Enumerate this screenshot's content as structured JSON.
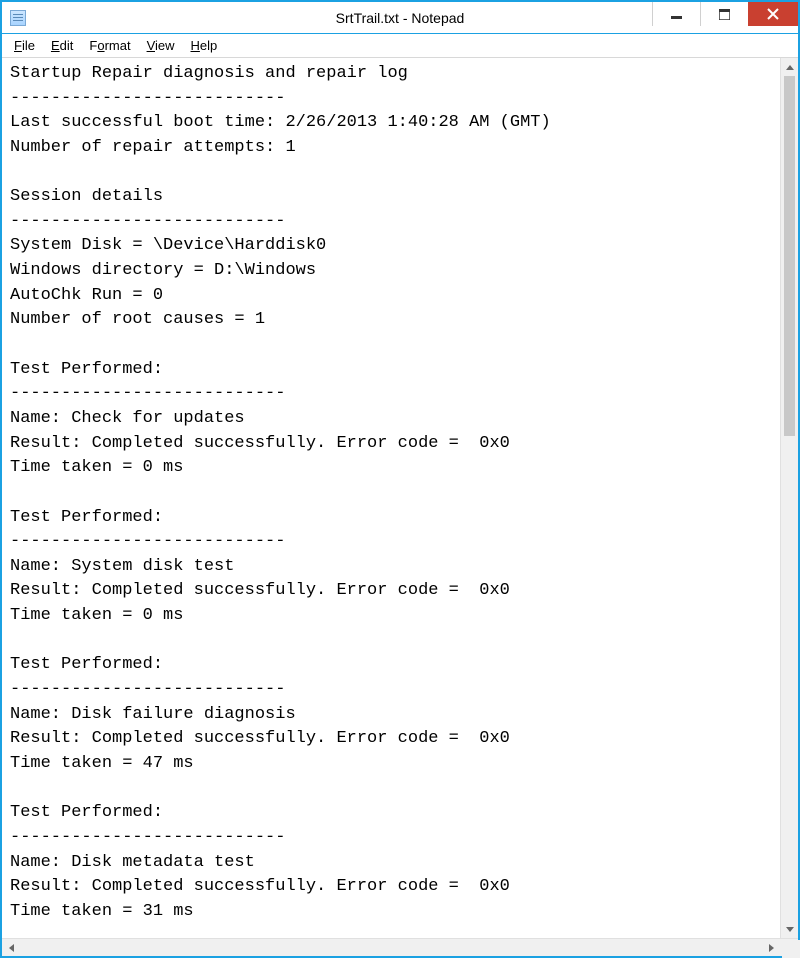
{
  "window": {
    "title": "SrtTrail.txt - Notepad"
  },
  "menu": {
    "file": "File",
    "edit": "Edit",
    "format": "Format",
    "view": "View",
    "help": "Help"
  },
  "document": {
    "text": "Startup Repair diagnosis and repair log\n---------------------------\nLast successful boot time: 2/26/2013 1:40:28 AM (GMT)\nNumber of repair attempts: 1\n\nSession details\n---------------------------\nSystem Disk = \\Device\\Harddisk0\nWindows directory = D:\\Windows\nAutoChk Run = 0\nNumber of root causes = 1\n\nTest Performed:\n---------------------------\nName: Check for updates\nResult: Completed successfully. Error code =  0x0\nTime taken = 0 ms\n\nTest Performed:\n---------------------------\nName: System disk test\nResult: Completed successfully. Error code =  0x0\nTime taken = 0 ms\n\nTest Performed:\n---------------------------\nName: Disk failure diagnosis\nResult: Completed successfully. Error code =  0x0\nTime taken = 47 ms\n\nTest Performed:\n---------------------------\nName: Disk metadata test\nResult: Completed successfully. Error code =  0x0\nTime taken = 31 ms"
  }
}
